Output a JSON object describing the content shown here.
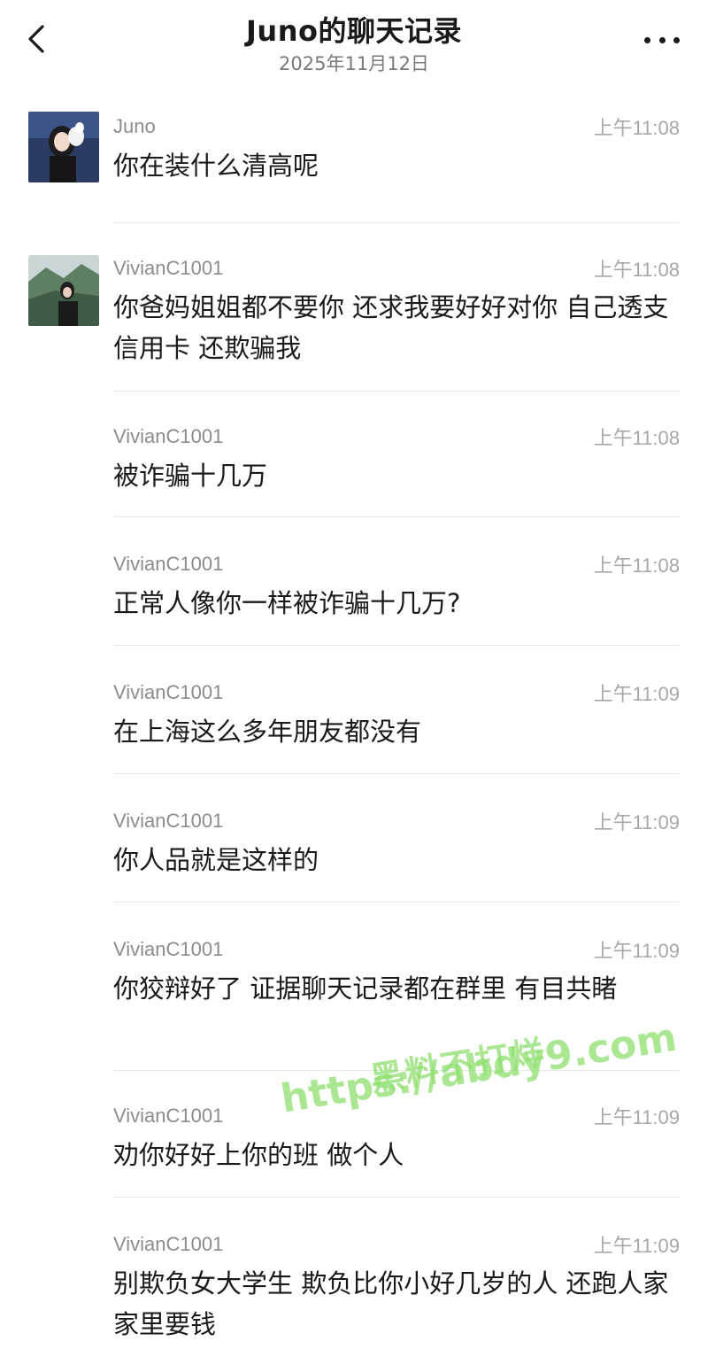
{
  "header": {
    "title": "Juno的聊天记录",
    "date": "2025年11月12日"
  },
  "messages": [
    {
      "sender": "Juno",
      "time": "上午11:08",
      "text": "你在装什么清高呢",
      "avatar": "avatar-juno"
    },
    {
      "sender": "VivianC1001",
      "time": "上午11:08",
      "text": "你爸妈姐姐都不要你 还求我要好好对你 自己透支信用卡 还欺骗我",
      "avatar": "avatar-vivian"
    },
    {
      "sender": "VivianC1001",
      "time": "上午11:08",
      "text": "被诈骗十几万"
    },
    {
      "sender": "VivianC1001",
      "time": "上午11:08",
      "text": "正常人像你一样被诈骗十几万?"
    },
    {
      "sender": "VivianC1001",
      "time": "上午11:09",
      "text": "在上海这么多年朋友都没有"
    },
    {
      "sender": "VivianC1001",
      "time": "上午11:09",
      "text": "你人品就是这样的"
    },
    {
      "sender": "VivianC1001",
      "time": "上午11:09",
      "text": "你狡辩好了 证据聊天记录都在群里 有目共睹"
    },
    {
      "sender": "VivianC1001",
      "time": "上午11:09",
      "text": "劝你好好上你的班 做个人"
    },
    {
      "sender": "VivianC1001",
      "time": "上午11:09",
      "text": "别欺负女大学生 欺负比你小好几岁的人 还跑人家家里要钱"
    }
  ],
  "watermark": {
    "line1": "黑料不打烊",
    "line2": "https://abdy9.com"
  },
  "icons": {
    "back": "chevron-left-icon",
    "more": "more-dots-icon"
  }
}
